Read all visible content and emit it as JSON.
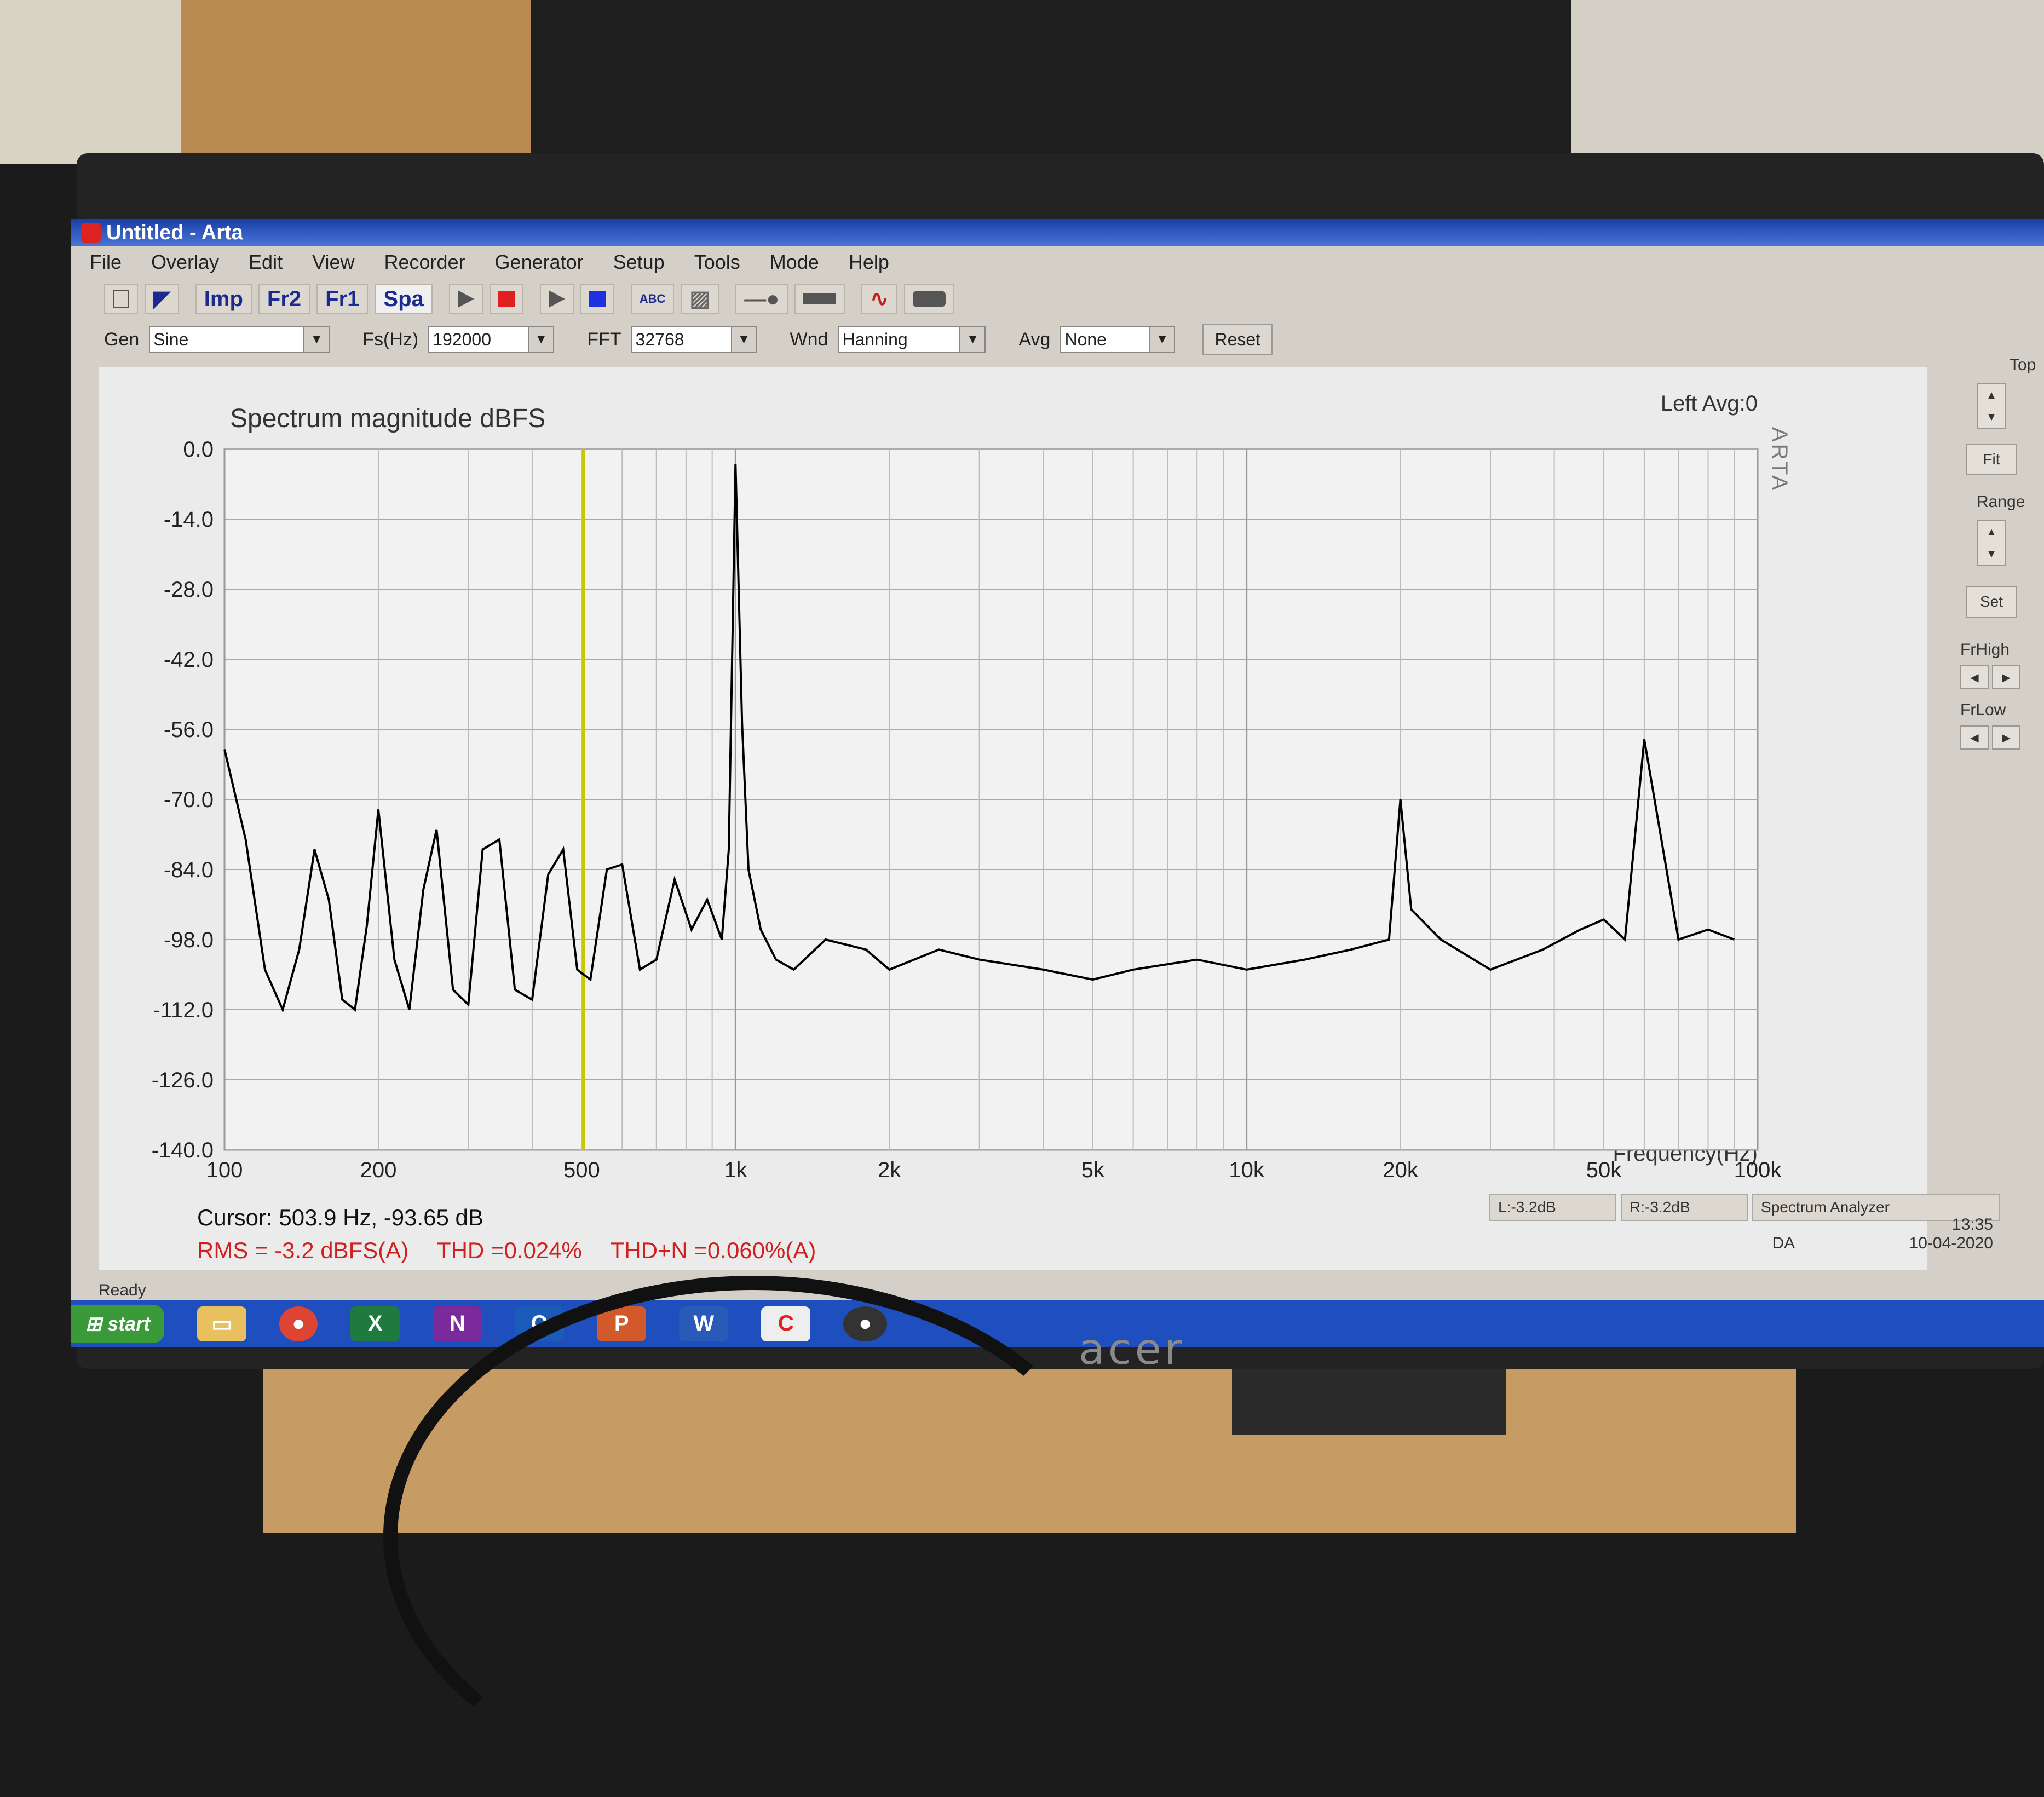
{
  "window": {
    "title": "Untitled - Arta"
  },
  "menu": [
    "File",
    "Overlay",
    "Edit",
    "View",
    "Recorder",
    "Generator",
    "Setup",
    "Tools",
    "Mode",
    "Help"
  ],
  "toolbar": {
    "imp": "Imp",
    "fr2": "Fr2",
    "fr1": "Fr1",
    "spa": "Spa",
    "abc": "ABC"
  },
  "controls": {
    "gen_label": "Gen",
    "gen_value": "Sine",
    "fs_label": "Fs(Hz)",
    "fs_value": "192000",
    "fft_label": "FFT",
    "fft_value": "32768",
    "wnd_label": "Wnd",
    "wnd_value": "Hanning",
    "avg_label": "Avg",
    "avg_value": "None",
    "reset_label": "Reset"
  },
  "side": {
    "top": "Top",
    "fit": "Fit",
    "range": "Range",
    "set": "Set",
    "frhigh": "FrHigh",
    "frlow": "FrLow"
  },
  "chart_data": {
    "type": "line",
    "title": "Spectrum magnitude dBFS",
    "channel": "Left  Avg:0",
    "watermark": "ARTA",
    "xlabel": "Frequency(Hz)",
    "xscale": "log",
    "xlim": [
      100,
      100000
    ],
    "ylim": [
      -140,
      0
    ],
    "yticks": [
      "0.0",
      "-14.0",
      "-28.0",
      "-42.0",
      "-56.0",
      "-70.0",
      "-84.0",
      "-98.0",
      "-112.0",
      "-126.0",
      "-140.0"
    ],
    "xticks": [
      {
        "v": 100,
        "label": "100"
      },
      {
        "v": 200,
        "label": "200"
      },
      {
        "v": 500,
        "label": "500"
      },
      {
        "v": 1000,
        "label": "1k"
      },
      {
        "v": 2000,
        "label": "2k"
      },
      {
        "v": 5000,
        "label": "5k"
      },
      {
        "v": 10000,
        "label": "10k"
      },
      {
        "v": 20000,
        "label": "20k"
      },
      {
        "v": 50000,
        "label": "50k"
      },
      {
        "v": 100000,
        "label": "100k"
      }
    ],
    "grid": true,
    "cursor_hz": 503.9,
    "series": [
      {
        "color": "#000000",
        "x": [
          100,
          110,
          120,
          130,
          140,
          150,
          160,
          170,
          180,
          190,
          200,
          215,
          230,
          245,
          260,
          280,
          300,
          320,
          345,
          370,
          400,
          430,
          460,
          490,
          520,
          560,
          600,
          650,
          700,
          760,
          820,
          880,
          940,
          970,
          1000,
          1030,
          1060,
          1120,
          1200,
          1300,
          1500,
          1800,
          2000,
          2500,
          3000,
          4000,
          5000,
          6000,
          8000,
          10000,
          13000,
          16000,
          19000,
          20000,
          21000,
          24000,
          30000,
          38000,
          45000,
          50000,
          55000,
          60000,
          70000,
          80000,
          90000
        ],
        "y": [
          -60,
          -78,
          -104,
          -112,
          -100,
          -80,
          -90,
          -110,
          -112,
          -95,
          -72,
          -102,
          -112,
          -88,
          -76,
          -108,
          -111,
          -80,
          -78,
          -108,
          -110,
          -85,
          -80,
          -104,
          -106,
          -84,
          -83,
          -104,
          -102,
          -86,
          -96,
          -90,
          -98,
          -80,
          -3,
          -55,
          -84,
          -96,
          -102,
          -104,
          -98,
          -100,
          -104,
          -100,
          -102,
          -104,
          -106,
          -104,
          -102,
          -104,
          -102,
          -100,
          -98,
          -70,
          -92,
          -98,
          -104,
          -100,
          -96,
          -94,
          -98,
          -58,
          -98,
          -96,
          -98
        ]
      }
    ]
  },
  "readout": {
    "cursor": "Cursor:   503.9 Hz, -93.65 dB",
    "rms": "RMS =   -3.2 dBFS(A)",
    "thd": "THD =0.024%",
    "thdn": "THD+N =0.060%(A)"
  },
  "status": {
    "left_level": "L:-3.2dB",
    "right_level": "R:-3.2dB",
    "mode": "Spectrum Analyzer",
    "ready": "Ready"
  },
  "taskbar": {
    "start": "start",
    "lang": "DA",
    "time": "13:35",
    "date": "10-04-2020"
  },
  "monitor": {
    "brand": "acer"
  }
}
